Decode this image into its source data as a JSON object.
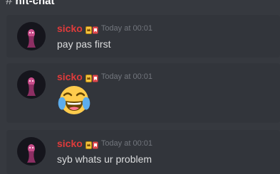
{
  "channel": {
    "hash": "#",
    "name": "nft-chat"
  },
  "messages": [
    {
      "username": "sicko",
      "timestamp": "Today at 00:01",
      "content": "pay pas first",
      "badge_icon": "crown-tag-icon"
    },
    {
      "username": "sicko",
      "timestamp": "Today at 00:01",
      "emoji": "face-with-tears-of-joy",
      "badge_icon": "crown-tag-icon"
    },
    {
      "username": "sicko",
      "timestamp": "Today at 00:01",
      "content": "syb whats ur problem",
      "badge_icon": "crown-tag-icon"
    }
  ],
  "colors": {
    "background": "#36393f",
    "message_background": "#32353b",
    "username": "#e03b3b",
    "timestamp": "#72767d",
    "text": "#dcddde"
  }
}
